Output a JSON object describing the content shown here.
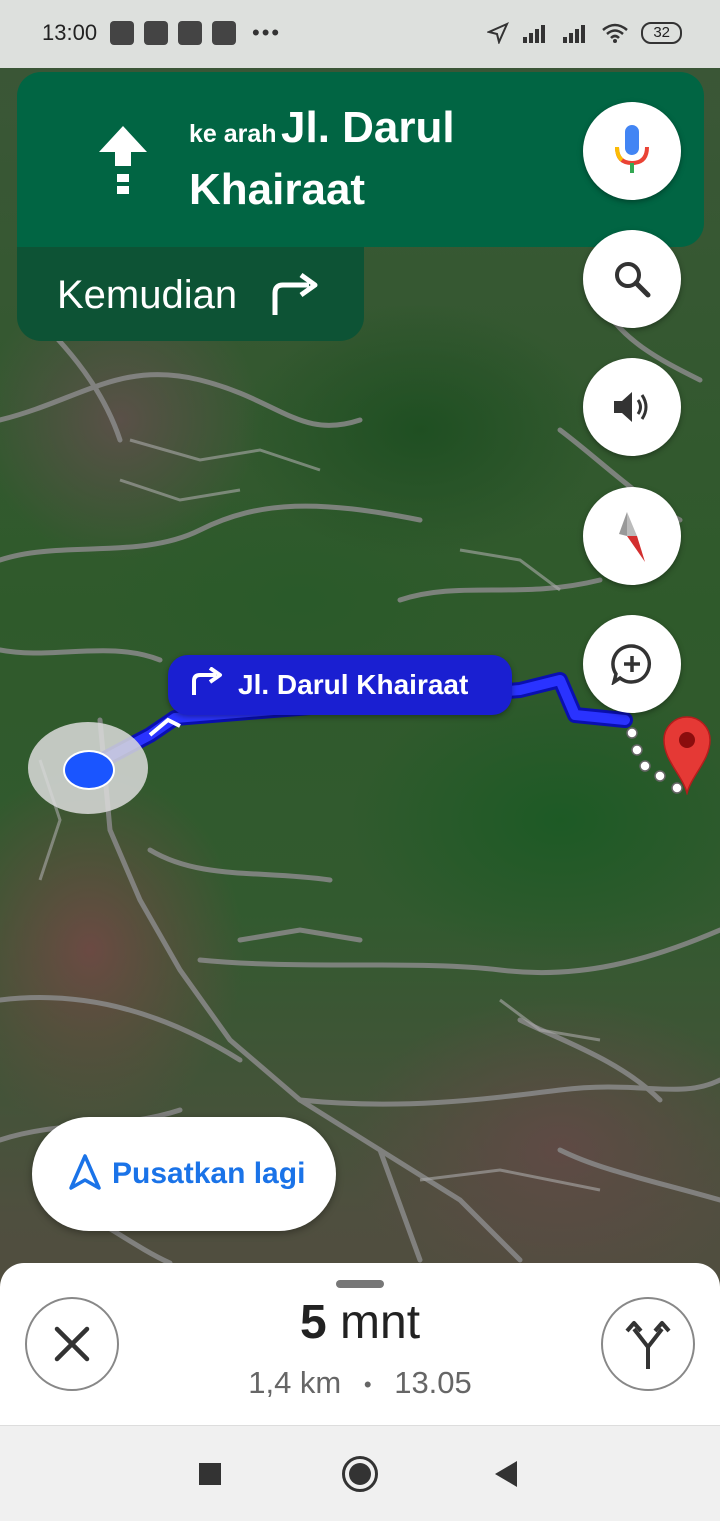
{
  "status_bar": {
    "time": "13:00",
    "battery": "32",
    "notification_icons": [
      "message-icon",
      "app-icon",
      "app-icon",
      "app-icon"
    ],
    "overflow": "•••"
  },
  "navigation": {
    "direction_prefix": "ke arah",
    "street": "Jl. Darul Khairaat",
    "then_label": "Kemudian",
    "then_icon": "turn-right-icon"
  },
  "map": {
    "route_label": "Jl. Darul Khairaat",
    "route_color": "#1a1fd1"
  },
  "controls": {
    "voice_search": "mic-icon",
    "search": "search-icon",
    "sound": "volume-icon",
    "compass": "compass-icon",
    "report": "add-report-icon",
    "recenter_label": "Pusatkan lagi"
  },
  "trip": {
    "duration_value": "5",
    "duration_unit": " mnt",
    "distance": "1,4 km",
    "separator": "•",
    "arrival": "13.05"
  },
  "colors": {
    "banner": "#016543",
    "accent": "#1a73e8"
  }
}
